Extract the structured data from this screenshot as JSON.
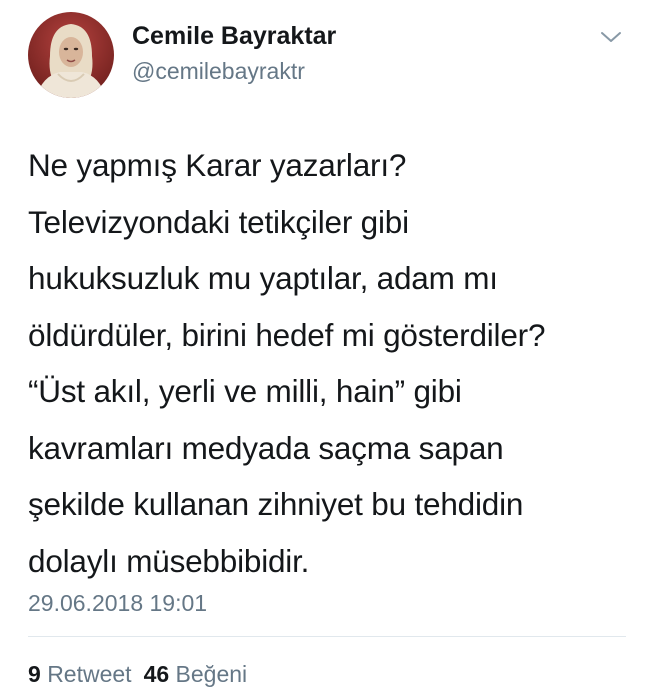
{
  "user": {
    "display_name": "Cemile Bayraktar",
    "handle": "@cemilebayraktr",
    "avatar_icon": "profile-photo"
  },
  "menu": {
    "icon": "chevron-down-icon"
  },
  "tweet": {
    "lines": [
      "Ne yapmış Karar yazarları?",
      "Televizyondaki tetikçiler gibi",
      "hukuksuzluk mu yaptılar, adam mı",
      "öldürdüler, birini hedef mi gösterdiler?",
      "“Üst akıl, yerli ve milli, hain” gibi",
      "kavramları medyada saçma sapan",
      "şekilde kullanan zihniyet bu tehdidin",
      "dolaylı müsebbibidir."
    ],
    "timestamp": "29.06.2018 19:01"
  },
  "stats": {
    "retweet_count": "9",
    "retweet_label": "Retweet",
    "like_count": "46",
    "like_label": "Beğeni"
  },
  "colors": {
    "text_primary": "#14171a",
    "text_secondary": "#657786",
    "divider": "#e1e8ed"
  }
}
